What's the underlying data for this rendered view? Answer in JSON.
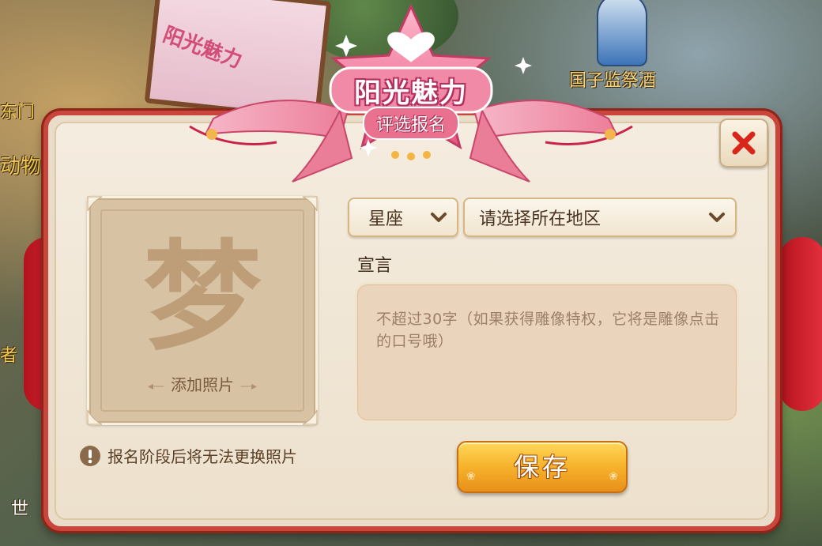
{
  "background": {
    "labels": [
      "阳光魅力",
      "国子监祭酒",
      "东门",
      "动物",
      "者",
      "世"
    ]
  },
  "dialog": {
    "title": "阳光魅力",
    "subtitle": "评选报名",
    "close_icon": "close-x-icon"
  },
  "photo": {
    "glyph": "梦",
    "add_label": "添加照片"
  },
  "notice": {
    "icon": "exclamation-icon",
    "text": "报名阶段后将无法更换照片"
  },
  "form": {
    "zodiac_select": "星座",
    "region_select": "请选择所在地区",
    "declaration_label": "宣言",
    "declaration_placeholder": "不超过30字（如果获得雕像特权，它将是雕像点击的口号哦）"
  },
  "save_button": "保存",
  "colors": {
    "frame_red": "#c8463b",
    "panel_bg": "#f4ecdf",
    "accent_gold": "#f7b22b",
    "title_pink": "#e86b8f"
  }
}
